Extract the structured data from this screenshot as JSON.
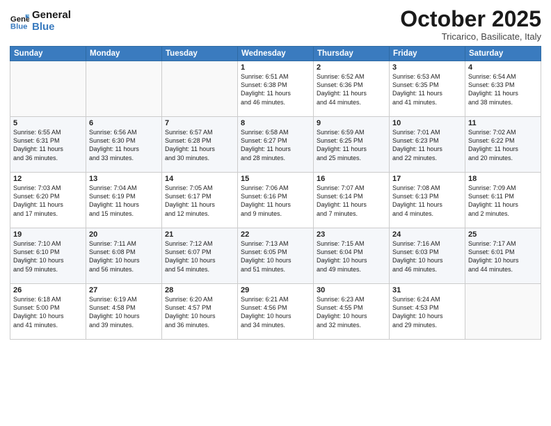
{
  "header": {
    "logo_general": "General",
    "logo_blue": "Blue",
    "month": "October 2025",
    "location": "Tricarico, Basilicate, Italy"
  },
  "days_of_week": [
    "Sunday",
    "Monday",
    "Tuesday",
    "Wednesday",
    "Thursday",
    "Friday",
    "Saturday"
  ],
  "weeks": [
    [
      {
        "day": "",
        "info": ""
      },
      {
        "day": "",
        "info": ""
      },
      {
        "day": "",
        "info": ""
      },
      {
        "day": "1",
        "info": "Sunrise: 6:51 AM\nSunset: 6:38 PM\nDaylight: 11 hours\nand 46 minutes."
      },
      {
        "day": "2",
        "info": "Sunrise: 6:52 AM\nSunset: 6:36 PM\nDaylight: 11 hours\nand 44 minutes."
      },
      {
        "day": "3",
        "info": "Sunrise: 6:53 AM\nSunset: 6:35 PM\nDaylight: 11 hours\nand 41 minutes."
      },
      {
        "day": "4",
        "info": "Sunrise: 6:54 AM\nSunset: 6:33 PM\nDaylight: 11 hours\nand 38 minutes."
      }
    ],
    [
      {
        "day": "5",
        "info": "Sunrise: 6:55 AM\nSunset: 6:31 PM\nDaylight: 11 hours\nand 36 minutes."
      },
      {
        "day": "6",
        "info": "Sunrise: 6:56 AM\nSunset: 6:30 PM\nDaylight: 11 hours\nand 33 minutes."
      },
      {
        "day": "7",
        "info": "Sunrise: 6:57 AM\nSunset: 6:28 PM\nDaylight: 11 hours\nand 30 minutes."
      },
      {
        "day": "8",
        "info": "Sunrise: 6:58 AM\nSunset: 6:27 PM\nDaylight: 11 hours\nand 28 minutes."
      },
      {
        "day": "9",
        "info": "Sunrise: 6:59 AM\nSunset: 6:25 PM\nDaylight: 11 hours\nand 25 minutes."
      },
      {
        "day": "10",
        "info": "Sunrise: 7:01 AM\nSunset: 6:23 PM\nDaylight: 11 hours\nand 22 minutes."
      },
      {
        "day": "11",
        "info": "Sunrise: 7:02 AM\nSunset: 6:22 PM\nDaylight: 11 hours\nand 20 minutes."
      }
    ],
    [
      {
        "day": "12",
        "info": "Sunrise: 7:03 AM\nSunset: 6:20 PM\nDaylight: 11 hours\nand 17 minutes."
      },
      {
        "day": "13",
        "info": "Sunrise: 7:04 AM\nSunset: 6:19 PM\nDaylight: 11 hours\nand 15 minutes."
      },
      {
        "day": "14",
        "info": "Sunrise: 7:05 AM\nSunset: 6:17 PM\nDaylight: 11 hours\nand 12 minutes."
      },
      {
        "day": "15",
        "info": "Sunrise: 7:06 AM\nSunset: 6:16 PM\nDaylight: 11 hours\nand 9 minutes."
      },
      {
        "day": "16",
        "info": "Sunrise: 7:07 AM\nSunset: 6:14 PM\nDaylight: 11 hours\nand 7 minutes."
      },
      {
        "day": "17",
        "info": "Sunrise: 7:08 AM\nSunset: 6:13 PM\nDaylight: 11 hours\nand 4 minutes."
      },
      {
        "day": "18",
        "info": "Sunrise: 7:09 AM\nSunset: 6:11 PM\nDaylight: 11 hours\nand 2 minutes."
      }
    ],
    [
      {
        "day": "19",
        "info": "Sunrise: 7:10 AM\nSunset: 6:10 PM\nDaylight: 10 hours\nand 59 minutes."
      },
      {
        "day": "20",
        "info": "Sunrise: 7:11 AM\nSunset: 6:08 PM\nDaylight: 10 hours\nand 56 minutes."
      },
      {
        "day": "21",
        "info": "Sunrise: 7:12 AM\nSunset: 6:07 PM\nDaylight: 10 hours\nand 54 minutes."
      },
      {
        "day": "22",
        "info": "Sunrise: 7:13 AM\nSunset: 6:05 PM\nDaylight: 10 hours\nand 51 minutes."
      },
      {
        "day": "23",
        "info": "Sunrise: 7:15 AM\nSunset: 6:04 PM\nDaylight: 10 hours\nand 49 minutes."
      },
      {
        "day": "24",
        "info": "Sunrise: 7:16 AM\nSunset: 6:03 PM\nDaylight: 10 hours\nand 46 minutes."
      },
      {
        "day": "25",
        "info": "Sunrise: 7:17 AM\nSunset: 6:01 PM\nDaylight: 10 hours\nand 44 minutes."
      }
    ],
    [
      {
        "day": "26",
        "info": "Sunrise: 6:18 AM\nSunset: 5:00 PM\nDaylight: 10 hours\nand 41 minutes."
      },
      {
        "day": "27",
        "info": "Sunrise: 6:19 AM\nSunset: 4:58 PM\nDaylight: 10 hours\nand 39 minutes."
      },
      {
        "day": "28",
        "info": "Sunrise: 6:20 AM\nSunset: 4:57 PM\nDaylight: 10 hours\nand 36 minutes."
      },
      {
        "day": "29",
        "info": "Sunrise: 6:21 AM\nSunset: 4:56 PM\nDaylight: 10 hours\nand 34 minutes."
      },
      {
        "day": "30",
        "info": "Sunrise: 6:23 AM\nSunset: 4:55 PM\nDaylight: 10 hours\nand 32 minutes."
      },
      {
        "day": "31",
        "info": "Sunrise: 6:24 AM\nSunset: 4:53 PM\nDaylight: 10 hours\nand 29 minutes."
      },
      {
        "day": "",
        "info": ""
      }
    ]
  ]
}
